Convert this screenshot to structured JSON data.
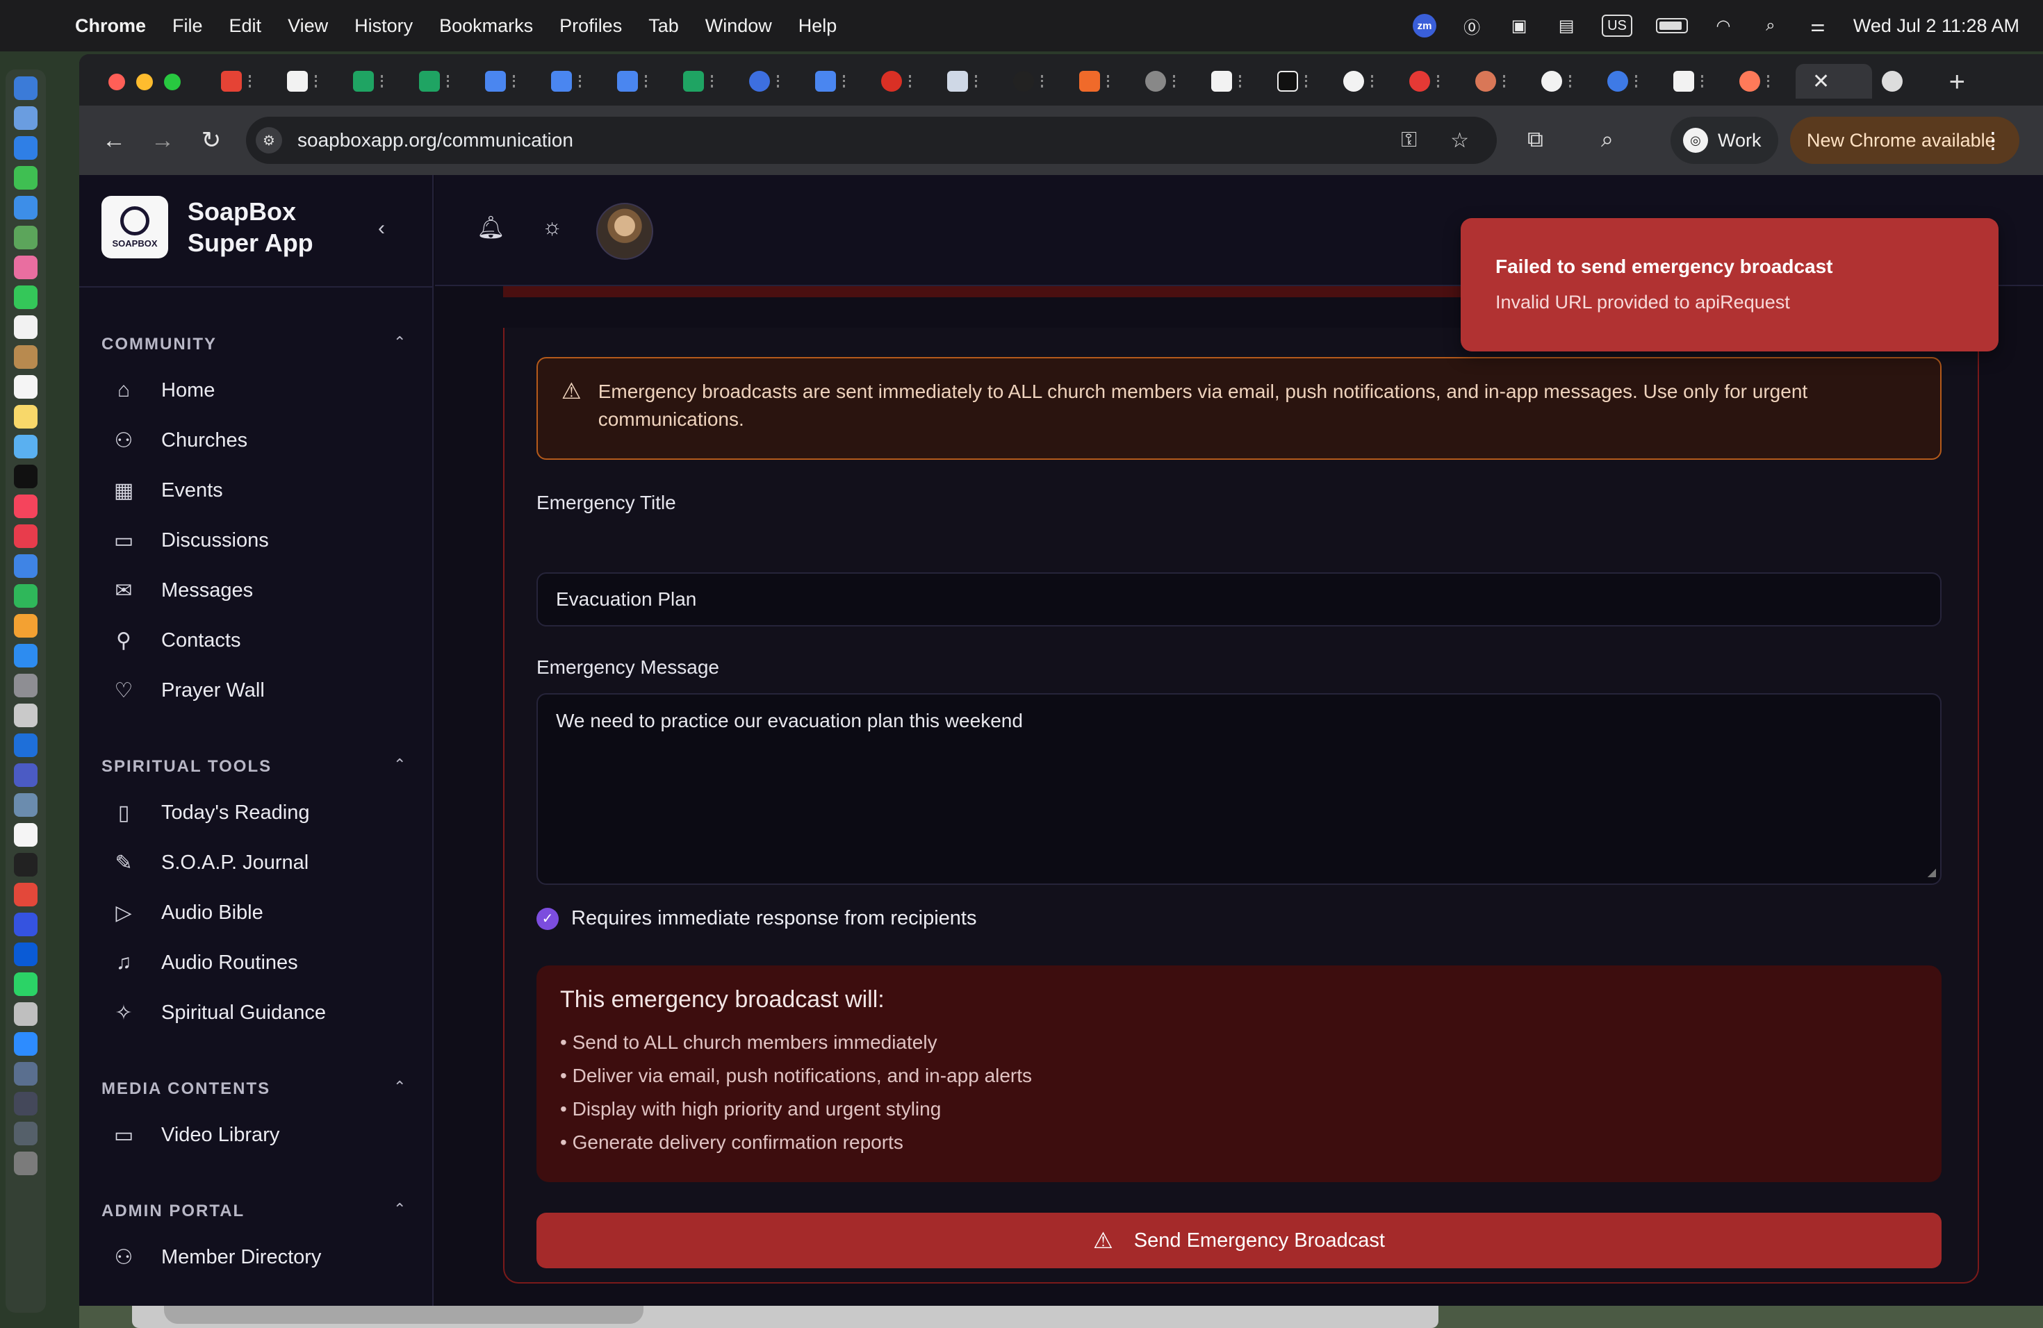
{
  "menubar": {
    "app": "Chrome",
    "items": [
      "File",
      "Edit",
      "View",
      "History",
      "Bookmarks",
      "Profiles",
      "Tab",
      "Window",
      "Help"
    ],
    "keyboard": "US",
    "clock": "Wed Jul 2  11:28 AM"
  },
  "browser": {
    "url": "soapboxapp.org/communication",
    "profile_label": "Work",
    "update_label": "New Chrome available"
  },
  "sidebar": {
    "brand_line1": "SoapBox",
    "brand_line2": "Super App",
    "logo_text": "SOAPBOX",
    "sections": [
      {
        "title": "COMMUNITY",
        "items": [
          "Home",
          "Churches",
          "Events",
          "Discussions",
          "Messages",
          "Contacts",
          "Prayer Wall"
        ]
      },
      {
        "title": "SPIRITUAL TOOLS",
        "items": [
          "Today's Reading",
          "S.O.A.P. Journal",
          "Audio Bible",
          "Audio Routines",
          "Spiritual Guidance"
        ]
      },
      {
        "title": "MEDIA CONTENTS",
        "items": [
          "Video Library"
        ]
      },
      {
        "title": "ADMIN PORTAL",
        "items": [
          "Member Directory"
        ]
      }
    ]
  },
  "main": {
    "warning": "Emergency broadcasts are sent immediately to ALL church members via email, push notifications, and in-app messages. Use only for urgent communications.",
    "title_label": "Emergency Title",
    "title_value": "Evacuation Plan",
    "message_label": "Emergency Message",
    "message_value": "We need to practice our evacuation plan this weekend",
    "checkbox_label": "Requires immediate response from recipients",
    "effects_heading": "This emergency broadcast will:",
    "effects": [
      "Send to ALL church members immediately",
      "Deliver via email, push notifications, and in-app alerts",
      "Display with high priority and urgent styling",
      "Generate delivery confirmation reports"
    ],
    "send_label": "Send Emergency Broadcast"
  },
  "toast": {
    "title": "Failed to send emergency broadcast",
    "description": "Invalid URL provided to apiRequest"
  },
  "colors": {
    "toast_bg": "#b13232",
    "send_button": "#a52a2a",
    "checkbox_accent": "#7c4dde",
    "warning_border": "#b45a1b"
  }
}
